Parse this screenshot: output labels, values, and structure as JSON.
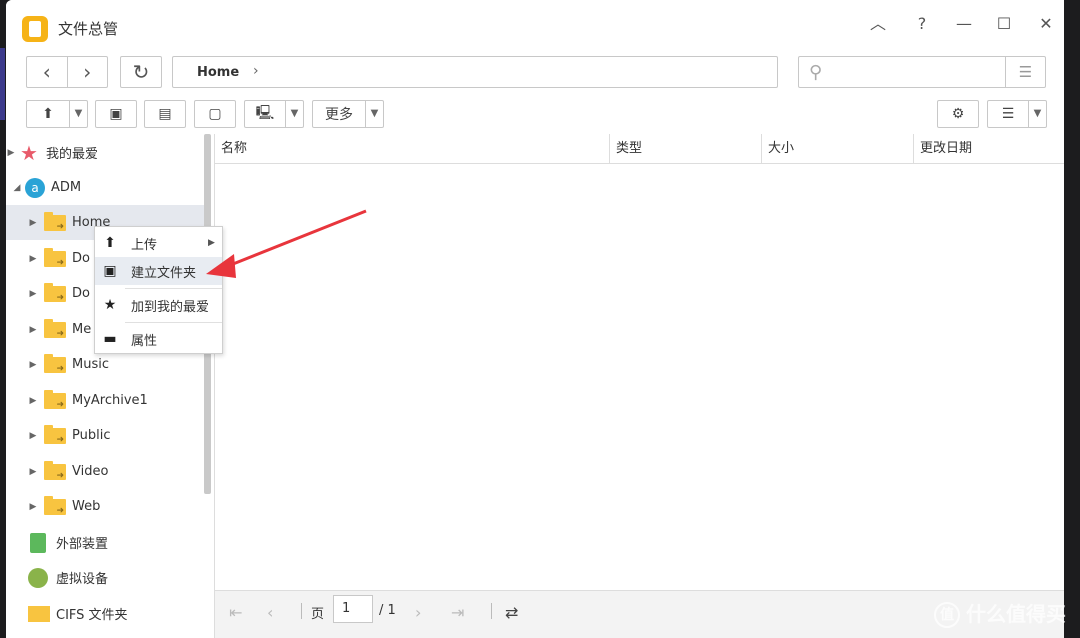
{
  "window": {
    "title": "文件总管"
  },
  "toolbar": {
    "path_home": "Home",
    "more_label": "更多"
  },
  "sidebar": {
    "favorites": "我的最爱",
    "adm": "ADM",
    "folders": [
      "Home",
      "Do",
      "Do",
      "Me",
      "Music",
      "MyArchive1",
      "Public",
      "Video",
      "Web"
    ],
    "external": "外部装置",
    "virtual": "虚拟设备",
    "cifs": "CIFS 文件夹"
  },
  "columns": [
    "名称",
    "类型",
    "大小",
    "更改日期"
  ],
  "context_menu": {
    "upload": "上传",
    "create_folder": "建立文件夹",
    "add_favorite": "加到我的最爱",
    "properties": "属性"
  },
  "pager": {
    "page_label": "页",
    "page_value": "1",
    "total": "/ 1"
  },
  "watermark": "什么值得买",
  "colors": {
    "accent_arrow": "#e8353c",
    "folder": "#f8c440",
    "app_icon": "#f6b317"
  }
}
